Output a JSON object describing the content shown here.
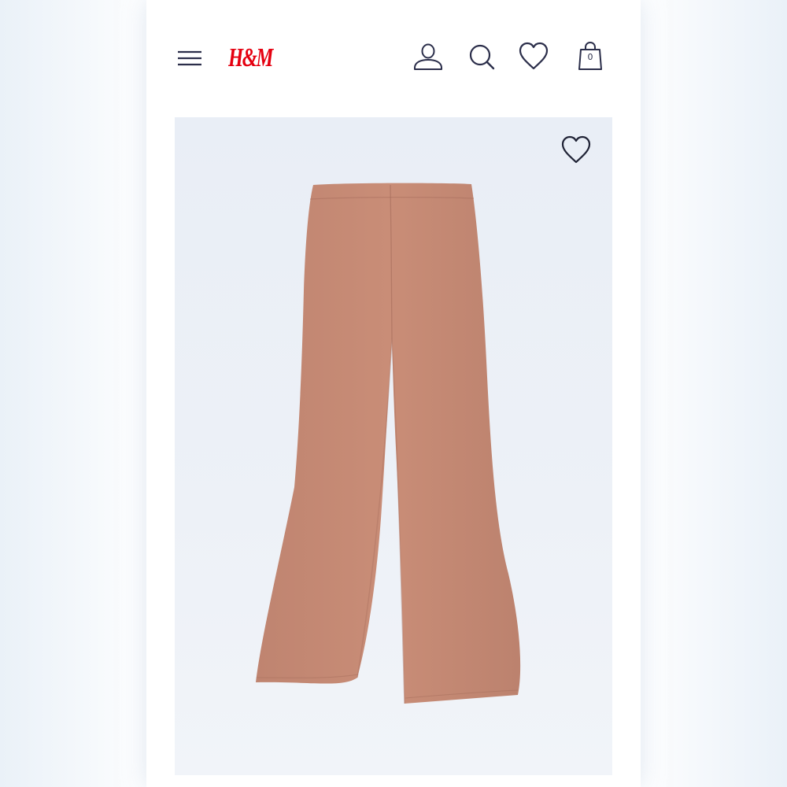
{
  "header": {
    "menu_icon": "hamburger-menu-icon",
    "logo_text": "H&M",
    "brand_color": "#e50010",
    "icon_color": "#2b2e4a",
    "account_icon": "user-icon",
    "search_icon": "search-icon",
    "favorites_icon": "heart-icon",
    "bag_icon": "shopping-bag-icon",
    "bag_count": "0"
  },
  "product": {
    "image_icon": "flared-trousers-image",
    "garment_color": "#c58a74",
    "favorite_icon": "heart-outline-icon"
  }
}
